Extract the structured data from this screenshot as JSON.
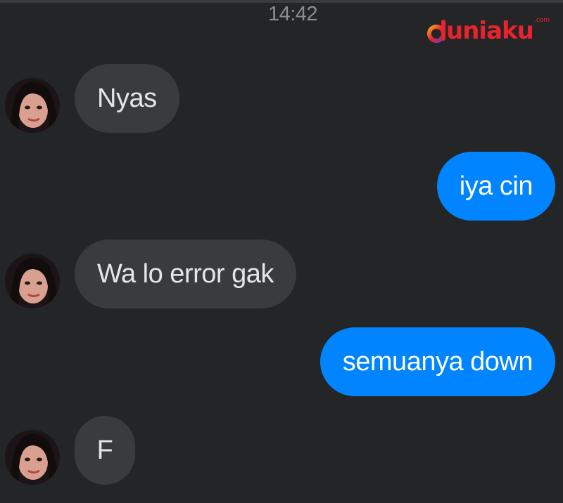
{
  "timestamp": "14:42",
  "logo": {
    "text": "duniaku",
    "suffix": ".com",
    "brand_color": "#e8232f"
  },
  "colors": {
    "background": "#242526",
    "incoming_bubble": "#3a3b3c",
    "outgoing_bubble": "#0084ff",
    "incoming_text": "#e4e6eb",
    "outgoing_text": "#ffffff"
  },
  "messages": [
    {
      "direction": "incoming",
      "text": "Nyas"
    },
    {
      "direction": "outgoing",
      "text": "iya cin"
    },
    {
      "direction": "incoming",
      "text": "Wa lo error gak"
    },
    {
      "direction": "outgoing",
      "text": "semuanya down"
    },
    {
      "direction": "incoming",
      "text": "F"
    }
  ]
}
